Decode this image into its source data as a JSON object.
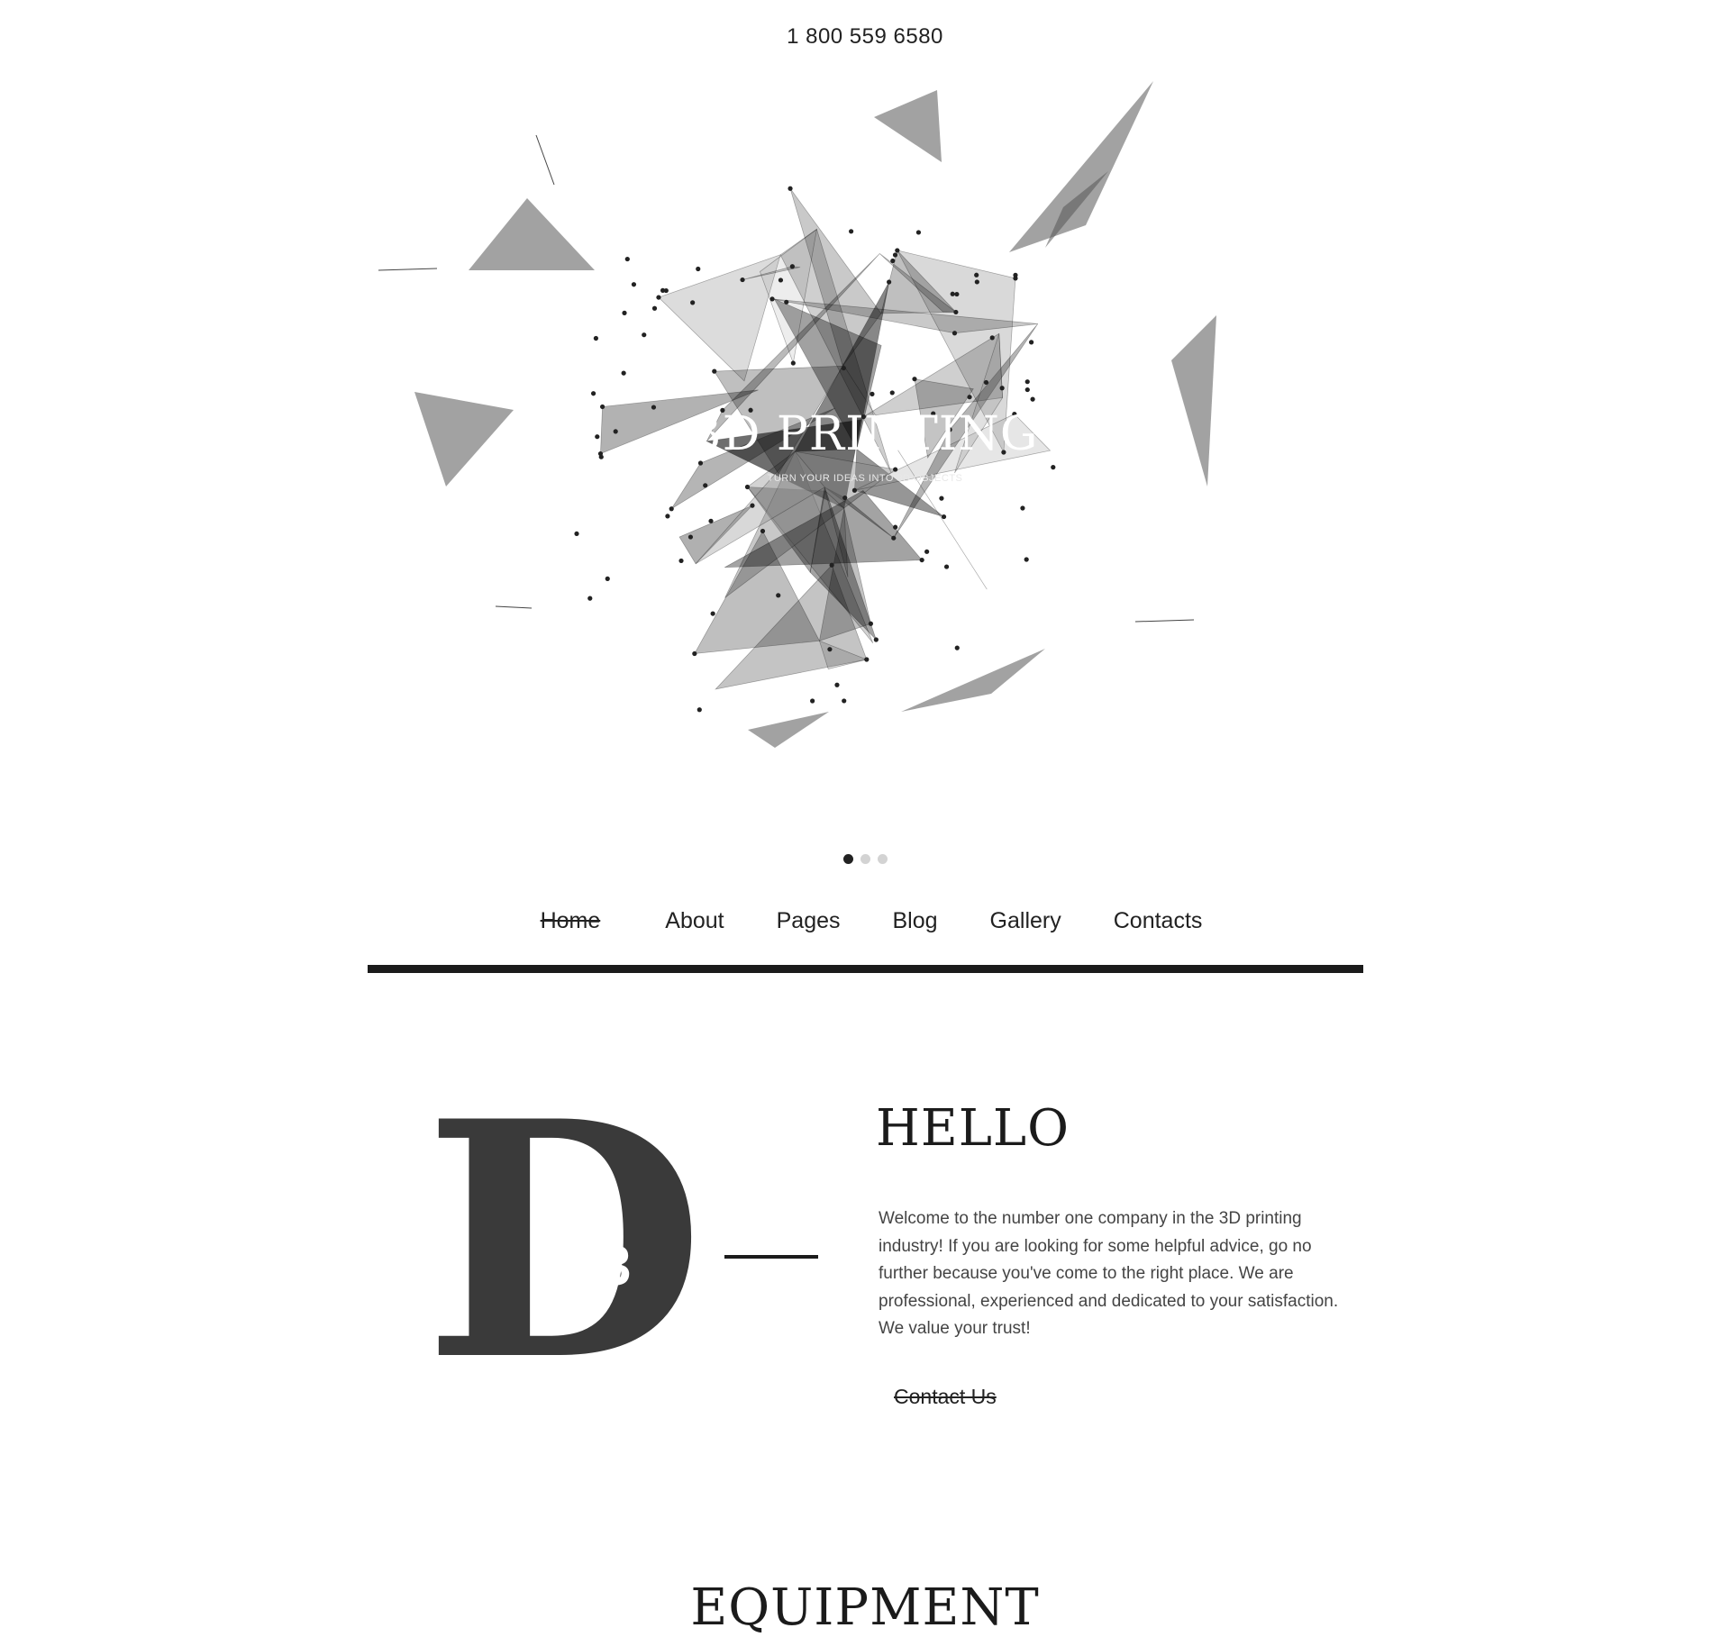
{
  "header": {
    "phone": "1 800 559 6580"
  },
  "hero": {
    "title": "3D PRINTING",
    "subtitle": "TURN YOUR IDEAS INTO 3D OBJECTS",
    "slides": 3,
    "active_slide": 1
  },
  "nav": {
    "items": [
      {
        "label": "Home",
        "active": true
      },
      {
        "label": "About"
      },
      {
        "label": "Pages"
      },
      {
        "label": "Blog"
      },
      {
        "label": "Gallery"
      },
      {
        "label": "Contacts"
      }
    ]
  },
  "logo": {
    "letter": "D",
    "superscript": "3"
  },
  "hello": {
    "title": "HELLO",
    "text": "Welcome to the number one company in the 3D printing industry! If you are looking for some helpful advice, go no further because you've come to the right place. We are professional, experienced and dedicated to your satisfaction. We value your trust!",
    "cta": "Contact Us"
  },
  "equipment": {
    "title": "EQUIPMENT"
  },
  "colors": {
    "text": "#222222",
    "rule": "#1b1b1b",
    "logo": "#3a3a3a",
    "dot_inactive": "#d3d3d3"
  }
}
